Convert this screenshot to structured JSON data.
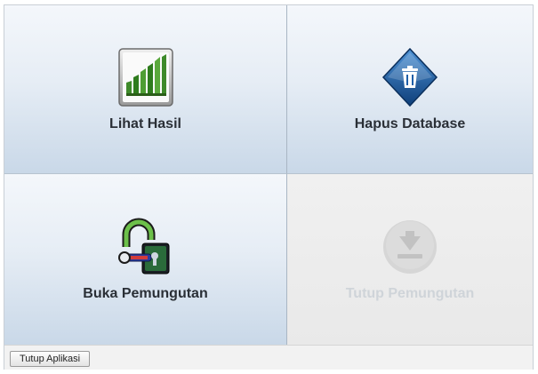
{
  "tiles": {
    "lihat_hasil": {
      "label": "Lihat Hasil",
      "icon": "bar-chart-icon",
      "enabled": true
    },
    "hapus_database": {
      "label": "Hapus Database",
      "icon": "trash-database-icon",
      "enabled": true
    },
    "buka_pemungutan": {
      "label": "Buka Pemungutan",
      "icon": "unlock-icon",
      "enabled": true
    },
    "tutup_pemungutan": {
      "label": "Tutup Pemungutan",
      "icon": "download-close-icon",
      "enabled": false
    }
  },
  "footer": {
    "close_app_label": "Tutup Aplikasi"
  },
  "colors": {
    "tile_gradient_top": "#f4f7fb",
    "tile_gradient_bottom": "#c9d8e8",
    "disabled_label": "#cfd4d9",
    "chart_green": "#3e8a2a",
    "diamond_blue": "#1f5fa8"
  }
}
